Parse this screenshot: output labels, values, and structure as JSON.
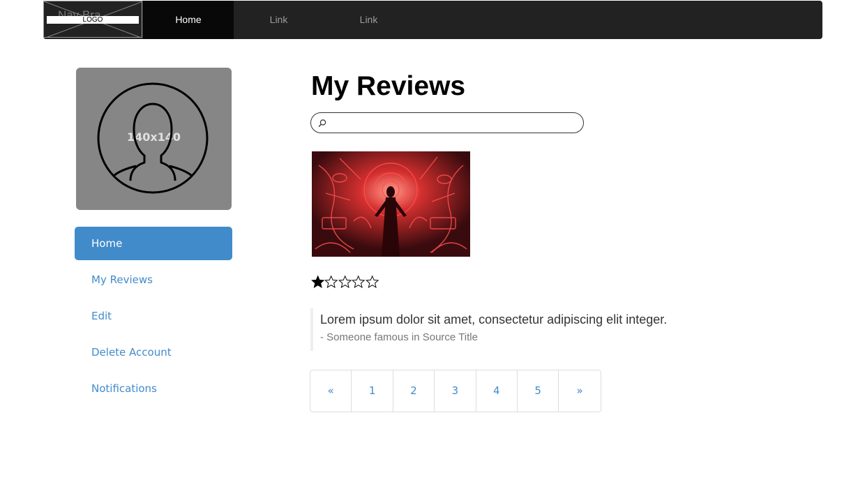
{
  "navbar": {
    "brand_ghost": "Nav Bra",
    "logo_label": "LOGO",
    "links": [
      {
        "label": "Home",
        "active": true
      },
      {
        "label": "Link",
        "active": false
      },
      {
        "label": "Link",
        "active": false
      }
    ]
  },
  "sidebar": {
    "avatar_placeholder": "140x140",
    "items": [
      {
        "label": "Home",
        "active": true
      },
      {
        "label": "My Reviews",
        "active": false
      },
      {
        "label": "Edit",
        "active": false
      },
      {
        "label": "Delete Account",
        "active": false
      },
      {
        "label": "Notifications",
        "active": false
      }
    ]
  },
  "main": {
    "title": "My Reviews",
    "search": {
      "value": "",
      "placeholder": ""
    },
    "review": {
      "rating": 1,
      "rating_max": 5,
      "quote": "Lorem ipsum dolor sit amet, consectetur adipiscing elit integer.",
      "source": "- Someone famous in Source Title"
    },
    "pagination": [
      "«",
      "1",
      "2",
      "3",
      "4",
      "5",
      "»"
    ]
  },
  "colors": {
    "navbar_bg": "#222222",
    "navbar_active_bg": "#080808",
    "accent": "#428bca",
    "avatar_bg": "#868686",
    "image_red": "#e23a3a"
  },
  "icons": {
    "logo": "placeholder-x-icon",
    "avatar": "user-silhouette-icon",
    "search": "search-icon",
    "star_filled": "star-filled-icon",
    "star_empty": "star-outline-icon"
  }
}
